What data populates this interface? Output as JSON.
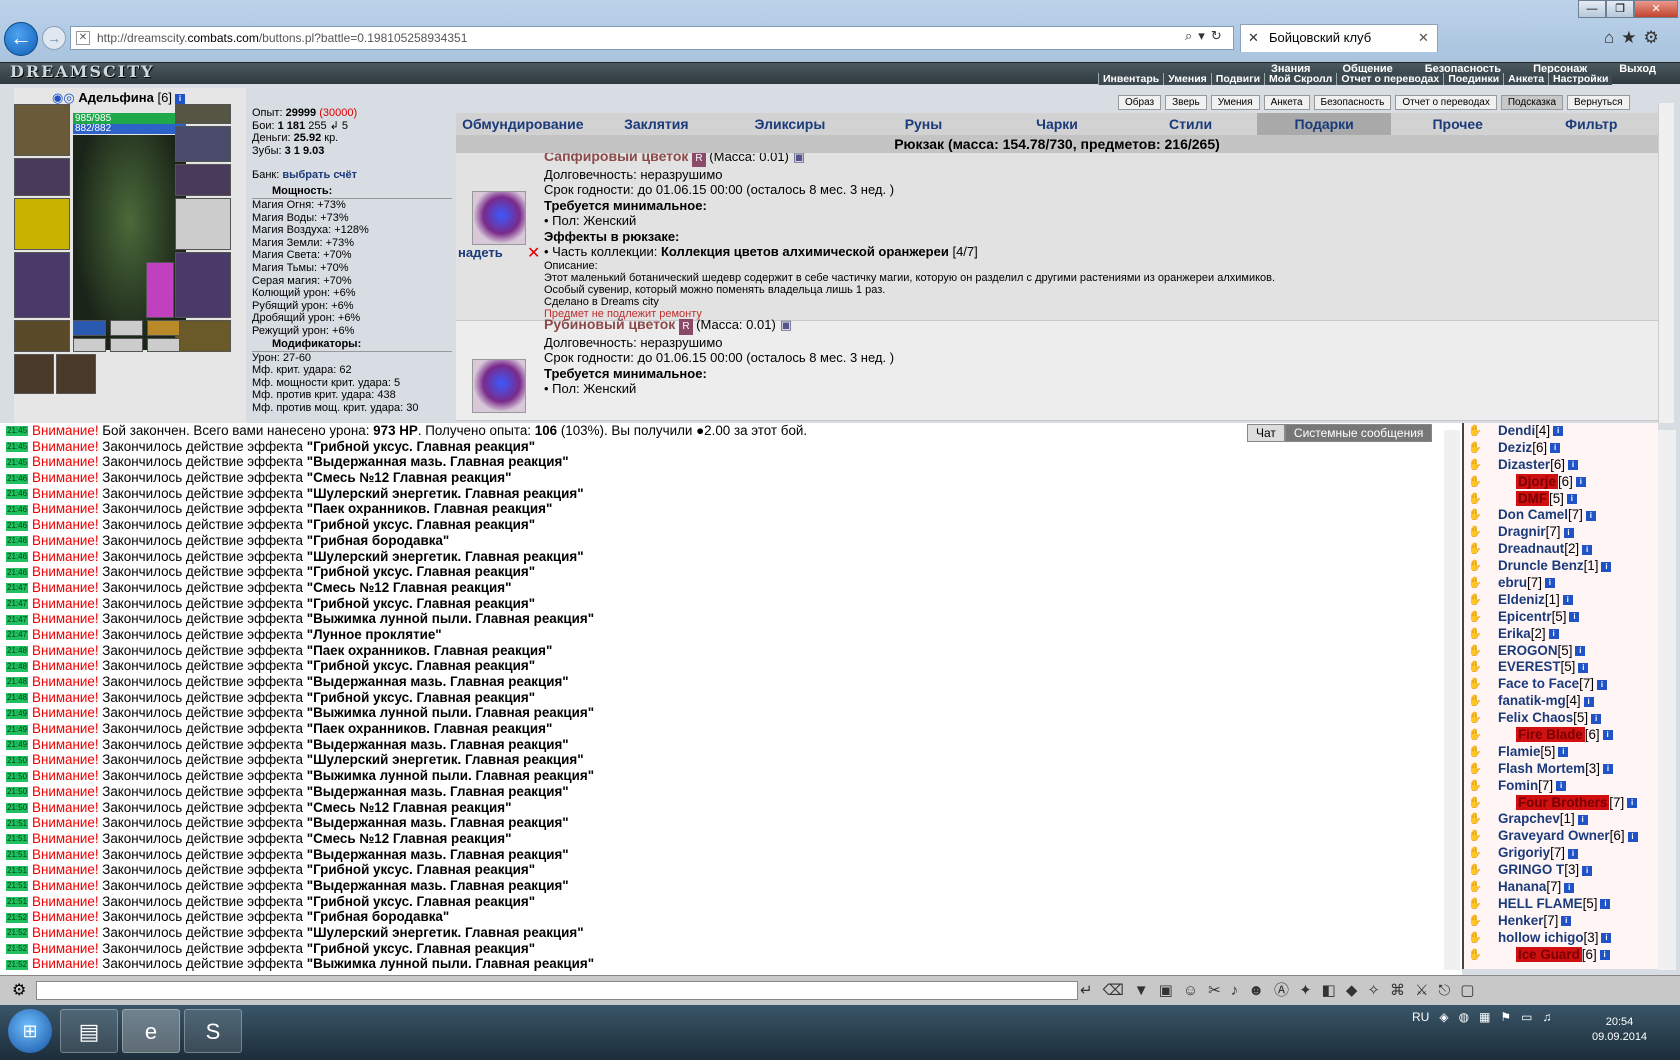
{
  "browser": {
    "url_prefix": "http://dreamscity.",
    "url_domain": "combats.com",
    "url_suffix": "/buttons.pl?battle=0.198105258934351",
    "tab_title": "Бойцовский клуб",
    "back_glyph": "←",
    "forward_glyph": "→",
    "icons": [
      "search-icon",
      "refresh-icon",
      "home-icon",
      "star-icon",
      "gear-icon"
    ]
  },
  "game": {
    "logo": "DREAMSCITY",
    "top_menu": [
      "Знания",
      "Общение",
      "Безопасность",
      "Персонаж",
      "Выход"
    ],
    "sub_menu": [
      "Инвентарь",
      "Умения",
      "Подвиги",
      "Мой Скролл",
      "Отчет о переводах",
      "Поединки",
      "Анкета",
      "Настройки"
    ]
  },
  "character": {
    "name": "Адельфина",
    "level": "[6]",
    "hp": "985/985",
    "mp": "882/882",
    "stats": [
      {
        "label": "Опыт:",
        "value": "29999",
        "extra": "(30000)"
      },
      {
        "label": "Бои:",
        "value": "1 181",
        "extra": "255 ↲  5"
      },
      {
        "label": "Деньги:",
        "value": "25.92",
        "extra": "кр."
      },
      {
        "label": "Зубы:",
        "value": "3 1 9.03",
        "extra": ""
      }
    ],
    "bank_label": "Банк:",
    "bank_link": "выбрать счёт",
    "power_title": "Мощность:",
    "power": [
      "Магия Огня: +73%",
      "Магия Воды: +73%",
      "Магия Воздуха: +128%",
      "Магия Земли: +73%",
      "Магия Света: +70%",
      "Магия Тьмы: +70%",
      "Серая магия: +70%",
      "Колющий урон: +6%",
      "Рубящий урон: +6%",
      "Дробящий урон: +6%",
      "Режущий урон: +6%"
    ],
    "mod_title": "Модификаторы:",
    "mods": [
      "Урон: 27-60",
      "Мф. крит. удара: 62",
      "Мф. мощности крит. удара: 5",
      "Мф. против крит. удара: 438",
      "Мф. против мощ. крит. удара: 30"
    ]
  },
  "top_buttons": [
    "Образ",
    "Зверь",
    "Умения",
    "Анкета",
    "Безопасность",
    "Отчет о переводах",
    "Подсказка",
    "Вернуться"
  ],
  "tabs": [
    "Обмундирование",
    "Заклятия",
    "Эликсиры",
    "Руны",
    "Чарки",
    "Стили",
    "Подарки",
    "Прочее",
    "Фильтр"
  ],
  "active_tab": "Подарки",
  "bag_title": "Рюкзак (масса: 154.78/730, предметов: 216/265)",
  "items": [
    {
      "name": "Сапфировый цветок",
      "badge": "R",
      "mass": "(Масса: 0.01)",
      "durability": "Долговечность: неразрушимо",
      "expiry": "Срок годности: до 01.06.15 00:00 (осталось 8 мес. 3 нед. )",
      "req_title": "Требуется минимальное:",
      "req": "• Пол: Женский",
      "eff_title": "Эффекты в рюкзаке:",
      "eff_prefix": "• Часть коллекции: ",
      "eff_value": "Коллекция цветов алхимической оранжереи",
      "eff_count": "[4/7]",
      "desc_title": "Описание:",
      "desc1": "Этот маленький ботанический шедевр содержит в себе частичку магии, которую он разделил с другими растениями из оранжереи алхимиков.",
      "desc2": "Особый сувенир, который можно поменять владельца лишь 1 раз.",
      "made": "Сделано в Dreams city",
      "norepair": "Предмет не подлежит ремонту",
      "wear": "надеть"
    },
    {
      "name": "Рубиновый цветок",
      "badge": "R",
      "mass": "(Масса: 0.01)",
      "durability": "Долговечность: неразрушимо",
      "expiry": "Срок годности: до 01.06.15 00:00 (осталось 8 мес. 3 нед. )",
      "req_title": "Требуется минимальное:",
      "req": "• Пол: Женский"
    }
  ],
  "chat": {
    "tabs": [
      "Чат",
      "Системные сообщения"
    ],
    "warn": "Внимание!",
    "first": {
      "time": "21:45",
      "text": " Бой закончен. Всего вами нанесено урона: ",
      "dmg": "973 HP",
      "mid": ". Получено опыта: ",
      "exp": "106",
      "tail": " (103%). Вы получили ●2.00 за этот бой."
    },
    "prefix": " Закончилось действие эффекта ",
    "rows": [
      {
        "t": "21:45",
        "e": "\"Грибной уксус. Главная реакция\""
      },
      {
        "t": "21:45",
        "e": "\"Выдержанная мазь. Главная реакция\""
      },
      {
        "t": "21:46",
        "e": "\"Смесь №12 Главная реакция\""
      },
      {
        "t": "21:46",
        "e": "\"Шулерский энергетик. Главная реакция\""
      },
      {
        "t": "21:46",
        "e": "\"Паек охранников. Главная реакция\""
      },
      {
        "t": "21:46",
        "e": "\"Грибной уксус. Главная реакция\""
      },
      {
        "t": "21:46",
        "e": "\"Грибная бородавка\""
      },
      {
        "t": "21:46",
        "e": "\"Шулерский энергетик. Главная реакция\""
      },
      {
        "t": "21:46",
        "e": "\"Грибной уксус. Главная реакция\""
      },
      {
        "t": "21:47",
        "e": "\"Смесь №12 Главная реакция\""
      },
      {
        "t": "21:47",
        "e": "\"Грибной уксус. Главная реакция\""
      },
      {
        "t": "21:47",
        "e": "\"Выжимка лунной пыли. Главная реакция\""
      },
      {
        "t": "21:47",
        "e": "\"Лунное проклятие\""
      },
      {
        "t": "21:48",
        "e": "\"Паек охранников. Главная реакция\""
      },
      {
        "t": "21:48",
        "e": "\"Грибной уксус. Главная реакция\""
      },
      {
        "t": "21:48",
        "e": "\"Выдержанная мазь. Главная реакция\""
      },
      {
        "t": "21:48",
        "e": "\"Грибной уксус. Главная реакция\""
      },
      {
        "t": "21:49",
        "e": "\"Выжимка лунной пыли. Главная реакция\""
      },
      {
        "t": "21:49",
        "e": "\"Паек охранников. Главная реакция\""
      },
      {
        "t": "21:49",
        "e": "\"Выдержанная мазь. Главная реакция\""
      },
      {
        "t": "21:50",
        "e": "\"Шулерский энергетик. Главная реакция\""
      },
      {
        "t": "21:50",
        "e": "\"Выжимка лунной пыли. Главная реакция\""
      },
      {
        "t": "21:50",
        "e": "\"Выдержанная мазь. Главная реакция\""
      },
      {
        "t": "21:50",
        "e": "\"Смесь №12 Главная реакция\""
      },
      {
        "t": "21:51",
        "e": "\"Выдержанная мазь. Главная реакция\""
      },
      {
        "t": "21:51",
        "e": "\"Смесь №12 Главная реакция\""
      },
      {
        "t": "21:51",
        "e": "\"Выдержанная мазь. Главная реакция\""
      },
      {
        "t": "21:51",
        "e": "\"Грибной уксус. Главная реакция\""
      },
      {
        "t": "21:51",
        "e": "\"Выдержанная мазь. Главная реакция\""
      },
      {
        "t": "21:51",
        "e": "\"Грибной уксус. Главная реакция\""
      },
      {
        "t": "21:52",
        "e": "\"Грибная бородавка\""
      },
      {
        "t": "21:52",
        "e": "\"Шулерский энергетик. Главная реакция\""
      },
      {
        "t": "21:52",
        "e": "\"Грибной уксус. Главная реакция\""
      },
      {
        "t": "21:52",
        "e": "\"Выжимка лунной пыли. Главная реакция\""
      }
    ]
  },
  "users": [
    {
      "n": "Dendi",
      "l": "[4]",
      "red": false
    },
    {
      "n": "Deziz",
      "l": "[6]",
      "red": false
    },
    {
      "n": "Dizaster",
      "l": "[6]",
      "red": false
    },
    {
      "n": "Djorje",
      "l": "[6]",
      "red": true
    },
    {
      "n": "DMF",
      "l": "[5]",
      "red": true
    },
    {
      "n": "Don Camel",
      "l": "[7]",
      "red": false
    },
    {
      "n": "Dragnir",
      "l": "[7]",
      "red": false
    },
    {
      "n": "Dreadnaut",
      "l": "[2]",
      "red": false
    },
    {
      "n": "Druncle Benz",
      "l": "[1]",
      "red": false
    },
    {
      "n": "ebru",
      "l": "[7]",
      "red": false
    },
    {
      "n": "Eldeniz",
      "l": "[1]",
      "red": false
    },
    {
      "n": "Epicentr",
      "l": "[5]",
      "red": false
    },
    {
      "n": "Erika",
      "l": "[2]",
      "red": false
    },
    {
      "n": "EROGON",
      "l": "[5]",
      "red": false
    },
    {
      "n": "EVEREST",
      "l": "[5]",
      "red": false
    },
    {
      "n": "Face to Face",
      "l": "[7]",
      "red": false
    },
    {
      "n": "fanatik-mg",
      "l": "[4]",
      "red": false
    },
    {
      "n": "Felix Chaos",
      "l": "[5]",
      "red": false
    },
    {
      "n": "Fire Blade",
      "l": "[6]",
      "red": true
    },
    {
      "n": "Flamie",
      "l": "[5]",
      "red": false
    },
    {
      "n": "Flash Mortem",
      "l": "[3]",
      "red": false
    },
    {
      "n": "Fomin",
      "l": "[7]",
      "red": false
    },
    {
      "n": "Four Brothers",
      "l": "[7]",
      "red": true
    },
    {
      "n": "Grapchev",
      "l": "[1]",
      "red": false
    },
    {
      "n": "Graveyard Owner",
      "l": "[6]",
      "red": false
    },
    {
      "n": "Grigoriy",
      "l": "[7]",
      "red": false
    },
    {
      "n": "GRINGO T",
      "l": "[3]",
      "red": false
    },
    {
      "n": "Hanana",
      "l": "[7]",
      "red": false
    },
    {
      "n": "HELL FLAME",
      "l": "[5]",
      "red": false
    },
    {
      "n": "Henker",
      "l": "[7]",
      "red": false
    },
    {
      "n": "hollow ichigo",
      "l": "[3]",
      "red": false
    },
    {
      "n": "Ice Guard",
      "l": "[6]",
      "red": true
    }
  ],
  "taskbar": {
    "lang": "RU",
    "time": "20:54",
    "date": "09.09.2014"
  }
}
